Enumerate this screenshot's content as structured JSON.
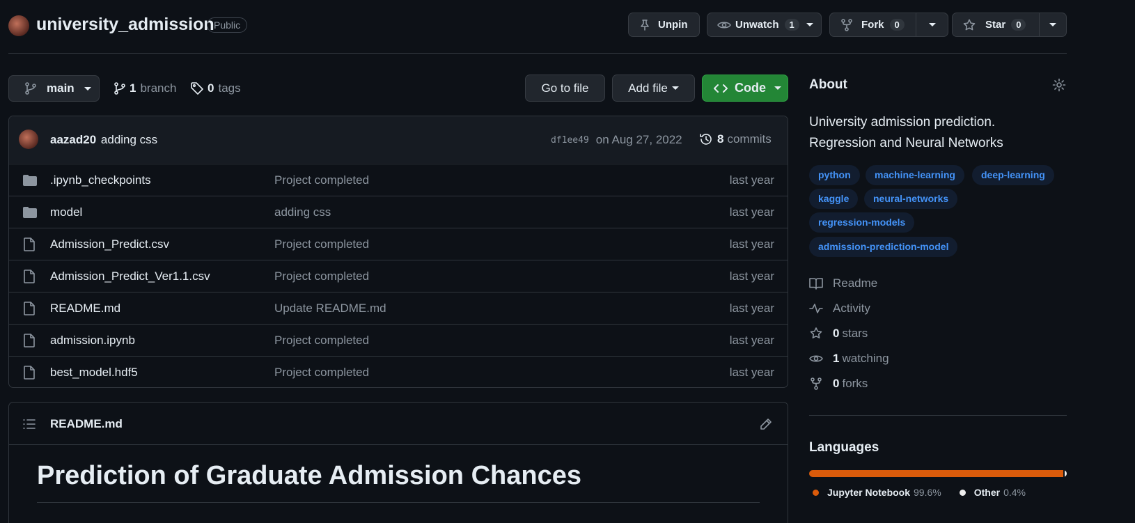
{
  "repo": {
    "name": "university_admission",
    "visibility": "Public"
  },
  "header_actions": {
    "unpin": "Unpin",
    "unwatch": "Unwatch",
    "watch_count": "1",
    "fork": "Fork",
    "fork_count": "0",
    "star": "Star",
    "star_count": "0"
  },
  "toolbar": {
    "branch": "main",
    "branch_count": "1",
    "branch_label": "branch",
    "tag_count": "0",
    "tag_label": "tags",
    "goto_file": "Go to file",
    "add_file": "Add file",
    "code": "Code"
  },
  "latest_commit": {
    "author": "aazad20",
    "message": "adding css",
    "sha": "df1ee49",
    "date": "on Aug 27, 2022",
    "commit_count": "8",
    "commit_label": "commits"
  },
  "files": [
    {
      "name": ".ipynb_checkpoints",
      "type": "folder",
      "message": "Project completed",
      "date": "last year"
    },
    {
      "name": "model",
      "type": "folder",
      "message": "adding css",
      "date": "last year"
    },
    {
      "name": "Admission_Predict.csv",
      "type": "file",
      "message": "Project completed",
      "date": "last year"
    },
    {
      "name": "Admission_Predict_Ver1.1.csv",
      "type": "file",
      "message": "Project completed",
      "date": "last year"
    },
    {
      "name": "README.md",
      "type": "file",
      "message": "Update README.md",
      "date": "last year"
    },
    {
      "name": "admission.ipynb",
      "type": "file",
      "message": "Project completed",
      "date": "last year"
    },
    {
      "name": "best_model.hdf5",
      "type": "file",
      "message": "Project completed",
      "date": "last year"
    }
  ],
  "readme": {
    "filename": "README.md",
    "heading": "Prediction of Graduate Admission Chances"
  },
  "about": {
    "title": "About",
    "description_line1": "University admission prediction.",
    "description_line2": "Regression and Neural Networks",
    "topics": [
      "python",
      "machine-learning",
      "deep-learning",
      "kaggle",
      "neural-networks",
      "regression-models",
      "admission-prediction-model"
    ],
    "readme_label": "Readme",
    "activity_label": "Activity",
    "stars_count": "0",
    "stars_label": "stars",
    "watching_count": "1",
    "watching_label": "watching",
    "forks_count": "0",
    "forks_label": "forks"
  },
  "languages": {
    "title": "Languages",
    "items": [
      {
        "name": "Jupyter Notebook",
        "percent": "99.6%",
        "value": 99.6,
        "color": "#DA5B0B"
      },
      {
        "name": "Other",
        "percent": "0.4%",
        "value": 0.4,
        "color": "#ededed"
      }
    ]
  }
}
